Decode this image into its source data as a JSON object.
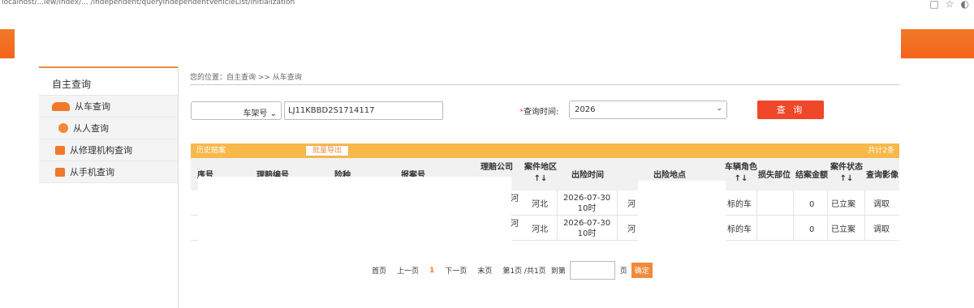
{
  "browser": {
    "url": "localhost/...iew/index/... /independent/queryIndependentVehicleList/initialization"
  },
  "sidebar": {
    "title": "自主查询",
    "items": [
      {
        "label": "从车查询",
        "icon": "car-icon"
      },
      {
        "label": "从人查询",
        "icon": "person-icon"
      },
      {
        "label": "从修理机构查询",
        "icon": "repair-icon"
      },
      {
        "label": "从手机查询",
        "icon": "phone-icon"
      }
    ]
  },
  "breadcrumb": "您的位置：自主查询 >> 从车查询",
  "query": {
    "type_select": "车架号",
    "vin_value": "LJ11KBBD2S1714117",
    "time_label": "查询时间:",
    "time_required": "*",
    "year": "2026",
    "button": "查 询"
  },
  "history": {
    "title": "历史赔案",
    "export": "批量导出",
    "total": "共计2条"
  },
  "table": {
    "headers": {
      "seq": "序号",
      "claim_no": "理赔编号",
      "insurance": "险种",
      "report_no": "报案号",
      "company": "理赔公司",
      "area": "案件地区↑↓",
      "time": "出险时间",
      "place": "出险地点",
      "role": "车辆角色↑↓",
      "loss": "损失部位",
      "amount": "结案金额",
      "status": "案件状态↑↓",
      "image": "查询影像"
    },
    "rows": [
      {
        "company": "河",
        "area": "河北",
        "time": "2026-07-30 10时",
        "place": "河",
        "role": "标的车",
        "loss": "",
        "amount": "0",
        "status": "已立案",
        "image": "调取"
      },
      {
        "company": "河",
        "area": "河北",
        "time": "2026-07-30 10时",
        "place": "河",
        "role": "标的车",
        "loss": "",
        "amount": "0",
        "status": "已立案",
        "image": "调取"
      }
    ]
  },
  "pager": {
    "first": "首页",
    "prev": "上一页",
    "current": "1",
    "next": "下一页",
    "last": "末页",
    "info": "第1页 /共1页",
    "goto": "到第",
    "page_unit": "页",
    "confirm": "确定"
  }
}
